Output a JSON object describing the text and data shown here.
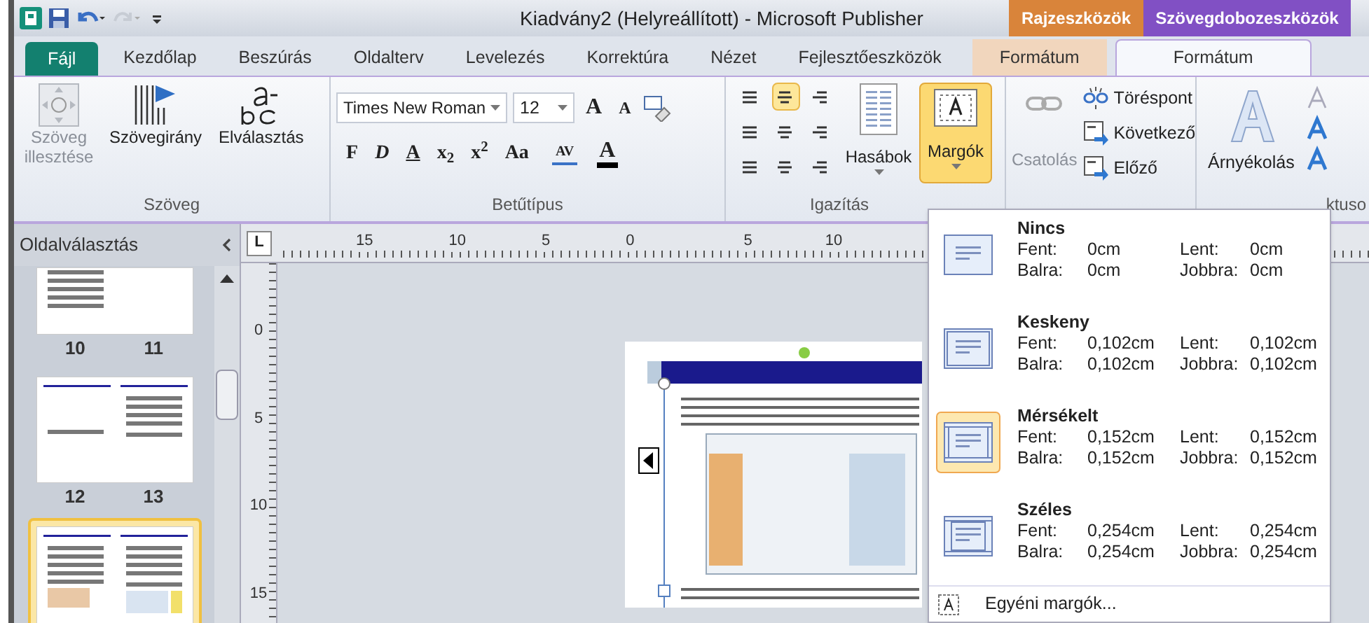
{
  "window": {
    "title": "Kiadvány2 (Helyreállított) - Microsoft Publisher"
  },
  "context_groups": [
    {
      "label": "Rajzeszközök",
      "color": "#d9843a"
    },
    {
      "label": "Szövegdobozeszközök",
      "color": "#8150c4"
    }
  ],
  "tabs": [
    {
      "label": "Fájl",
      "kind": "file",
      "selected": false
    },
    {
      "label": "Kezdőlap",
      "kind": "normal",
      "selected": false
    },
    {
      "label": "Beszúrás",
      "kind": "normal",
      "selected": false
    },
    {
      "label": "Oldalterv",
      "kind": "normal",
      "selected": false
    },
    {
      "label": "Levelezés",
      "kind": "normal",
      "selected": false
    },
    {
      "label": "Korrektúra",
      "kind": "normal",
      "selected": false
    },
    {
      "label": "Nézet",
      "kind": "normal",
      "selected": false
    },
    {
      "label": "Fejlesztőeszközök",
      "kind": "normal",
      "selected": false
    },
    {
      "label": "Formátum",
      "kind": "context",
      "selected": false
    },
    {
      "label": "Formátum",
      "kind": "context",
      "selected": true
    }
  ],
  "ribbon": {
    "text_group": {
      "label": "Szöveg",
      "buttons": [
        {
          "label": "Szöveg illesztése",
          "disabled": true
        },
        {
          "label": "Szövegirány",
          "disabled": false
        },
        {
          "label": "Elválasztás",
          "disabled": false
        }
      ]
    },
    "font_group": {
      "label": "Betűtípus",
      "font": "Times New Roman",
      "size": "12",
      "grow": "A",
      "shrink": "A",
      "formats": [
        "F",
        "D",
        "A",
        "x$_{2}$",
        "x$^{2}$",
        "Aa"
      ],
      "spacing": "AV",
      "font_color": "A"
    },
    "align_group": {
      "label": "Igazítás",
      "aligns": [
        {
          "selected": false
        },
        {
          "selected": true
        },
        {
          "selected": false
        },
        {
          "selected": false
        },
        {
          "selected": false
        },
        {
          "selected": false
        },
        {
          "selected": false
        },
        {
          "selected": false
        },
        {
          "selected": false
        }
      ],
      "columns": "Hasábok",
      "margins": {
        "label": "Margók",
        "selected": true
      }
    },
    "link_group": {
      "link": {
        "label": "Csatolás",
        "disabled": true
      },
      "items": [
        "Töréspont",
        "Következő",
        "Előző"
      ]
    },
    "effects_group": {
      "shadow": "Árnyékolás",
      "label": "ktuso"
    }
  },
  "page_panel": {
    "title": "Oldalválasztás",
    "thumbnails": [
      {
        "pages": [
          "10",
          "11"
        ],
        "selected": false
      },
      {
        "pages": [
          "12",
          "13"
        ],
        "selected": false
      },
      {
        "selected": true
      }
    ]
  },
  "rulers": {
    "corner": "L",
    "horizontal": [
      "15",
      "10",
      "5",
      "0",
      "5",
      "10"
    ],
    "vertical": [
      "0",
      "5",
      "10",
      "15"
    ]
  },
  "margins_menu": {
    "options": [
      {
        "name": "Nincs",
        "selected": false,
        "fields": [
          {
            "label": "Fent:",
            "value": "0cm"
          },
          {
            "label": "Lent:",
            "value": "0cm"
          },
          {
            "label": "Balra:",
            "value": "0cm"
          },
          {
            "label": "Jobbra:",
            "value": "0cm"
          }
        ]
      },
      {
        "name": "Keskeny",
        "selected": false,
        "fields": [
          {
            "label": "Fent:",
            "value": "0,102cm"
          },
          {
            "label": "Lent:",
            "value": "0,102cm"
          },
          {
            "label": "Balra:",
            "value": "0,102cm"
          },
          {
            "label": "Jobbra:",
            "value": "0,102cm"
          }
        ]
      },
      {
        "name": "Mérsékelt",
        "selected": true,
        "fields": [
          {
            "label": "Fent:",
            "value": "0,152cm"
          },
          {
            "label": "Lent:",
            "value": "0,152cm"
          },
          {
            "label": "Balra:",
            "value": "0,152cm"
          },
          {
            "label": "Jobbra:",
            "value": "0,152cm"
          }
        ]
      },
      {
        "name": "Széles",
        "selected": false,
        "fields": [
          {
            "label": "Fent:",
            "value": "0,254cm"
          },
          {
            "label": "Lent:",
            "value": "0,254cm"
          },
          {
            "label": "Balra:",
            "value": "0,254cm"
          },
          {
            "label": "Jobbra:",
            "value": "0,254cm"
          }
        ]
      }
    ],
    "custom": "Egyéni margók..."
  }
}
